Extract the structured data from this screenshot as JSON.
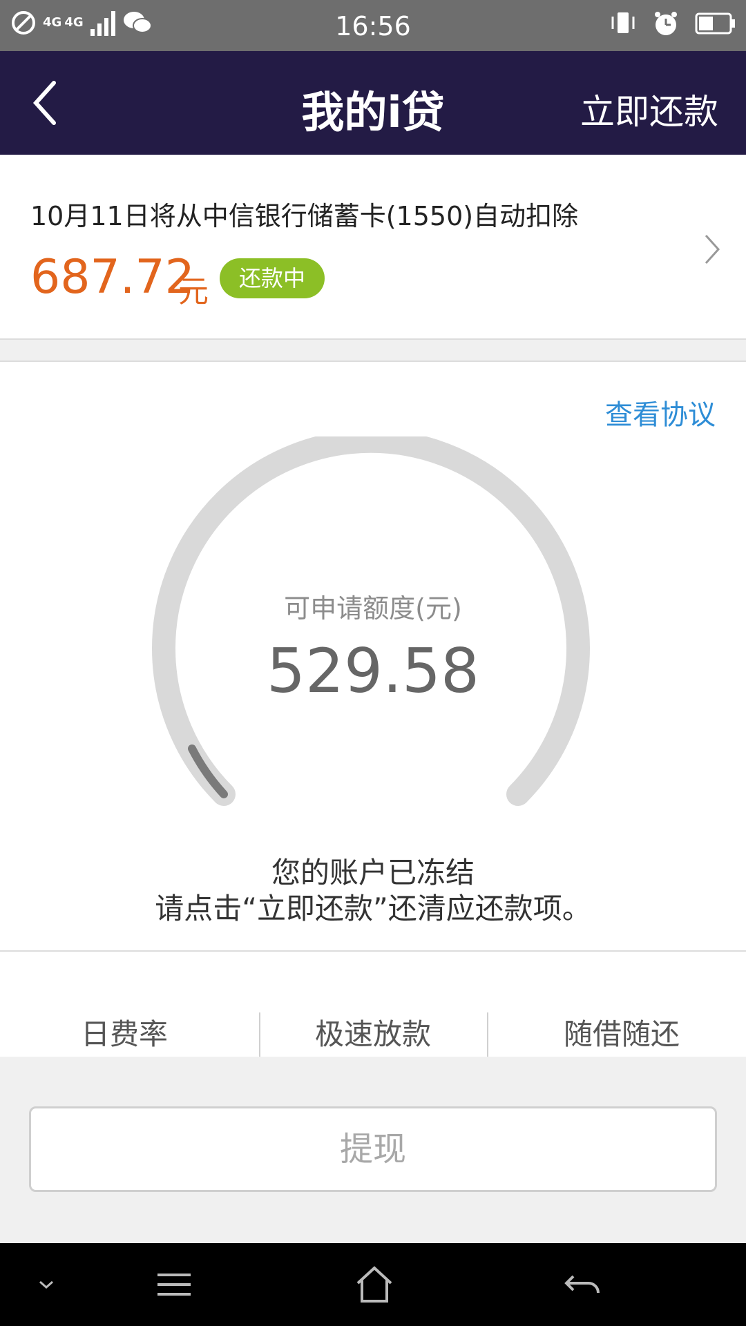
{
  "status_bar": {
    "time": "16:56",
    "network_1": "4G",
    "network_2": "4G",
    "icons": [
      "dnd-icon",
      "signal-icon",
      "wechat-icon",
      "vibrate-icon",
      "alarm-icon",
      "battery-icon"
    ]
  },
  "app_bar": {
    "title": "我的i贷",
    "action_label": "立即还款"
  },
  "repayment": {
    "description": "10月11日将从中信银行储蓄卡(1550)自动扣除",
    "amount": "687.72",
    "unit": "元",
    "status_badge": "还款中"
  },
  "credit": {
    "agreement_link": "查看协议",
    "label": "可申请额度(元)",
    "value": "529.58",
    "notice_line1": "您的账户已冻结",
    "notice_line2": "请点击“立即还款”还清应还款项。"
  },
  "features": [
    "日费率",
    "极速放款",
    "随借随还"
  ],
  "withdraw_label": "提现",
  "colors": {
    "header": "#231b45",
    "amount": "#e2651d",
    "badge": "#8cbf26",
    "link": "#2e8dd6"
  }
}
